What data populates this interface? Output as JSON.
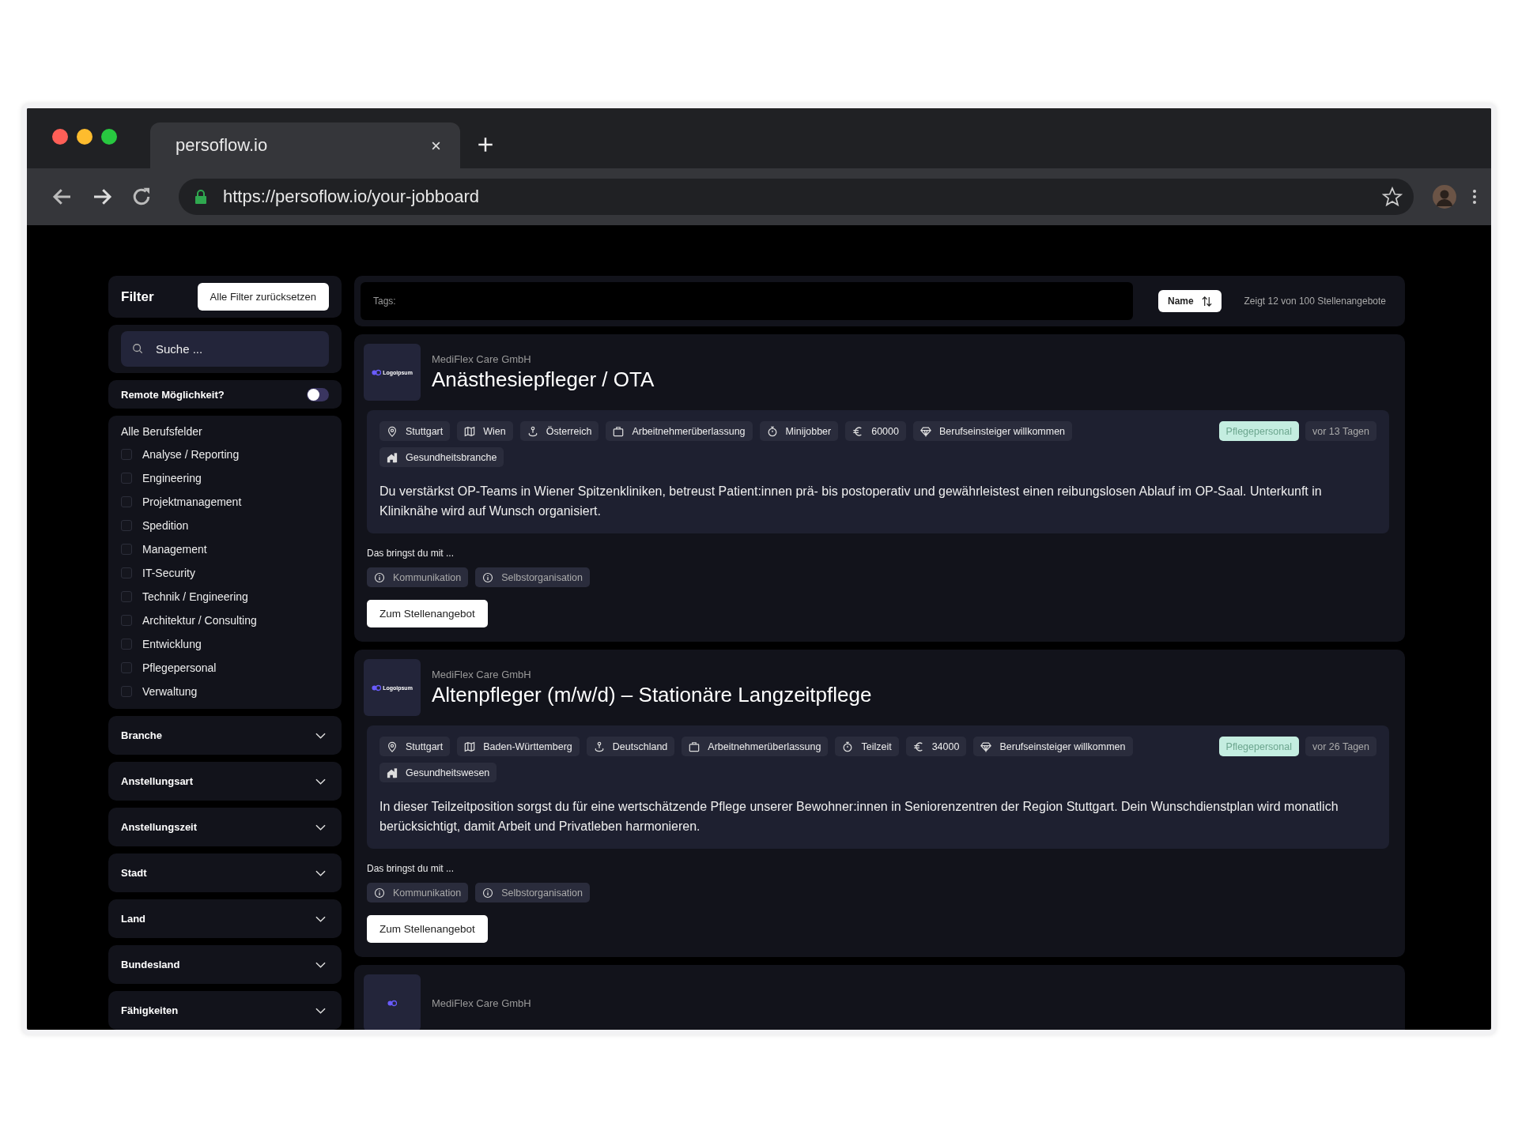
{
  "browser": {
    "tab_title": "persoflow.io",
    "url": "https://persoflow.io/your-jobboard"
  },
  "sidebar": {
    "title": "Filter",
    "reset_button": "Alle Filter zurücksetzen",
    "search_placeholder": "Suche ...",
    "remote": {
      "label": "Remote Möglichkeit?",
      "on": false
    },
    "fields": {
      "title": "Alle Berufsfelder",
      "items": [
        {
          "label": "Analyse / Reporting",
          "checked": false
        },
        {
          "label": "Engineering",
          "checked": false
        },
        {
          "label": "Projektmanagement",
          "checked": false
        },
        {
          "label": "Spedition",
          "checked": false
        },
        {
          "label": "Management",
          "checked": false
        },
        {
          "label": "IT-Security",
          "checked": false
        },
        {
          "label": "Technik / Engineering",
          "checked": false
        },
        {
          "label": "Architektur / Consulting",
          "checked": false
        },
        {
          "label": "Entwicklung",
          "checked": false
        },
        {
          "label": "Pflegepersonal",
          "checked": false
        },
        {
          "label": "Verwaltung",
          "checked": false
        }
      ]
    },
    "sections": [
      {
        "label": "Branche",
        "expanded": false
      },
      {
        "label": "Anstellungsart",
        "expanded": false
      },
      {
        "label": "Anstellungszeit",
        "expanded": false
      },
      {
        "label": "Stadt",
        "expanded": false
      },
      {
        "label": "Land",
        "expanded": false
      },
      {
        "label": "Bundesland",
        "expanded": false
      },
      {
        "label": "Fähigkeiten",
        "expanded": false
      }
    ]
  },
  "toolbar": {
    "tags_label": "Tags:",
    "sort_button": "Name",
    "count": "Zeigt 12 von 100 Stellenangebote"
  },
  "jobs": [
    {
      "logo_text": "Logoipsum",
      "company": "MediFlex Care GmbH",
      "title": "Anästhesiepfleger / OTA",
      "tags": [
        {
          "kind": "city",
          "label": "Stuttgart"
        },
        {
          "kind": "region",
          "label": "Wien"
        },
        {
          "kind": "country",
          "label": "Österreich"
        },
        {
          "kind": "type",
          "label": "Arbeitnehmerüberlassung"
        },
        {
          "kind": "time",
          "label": "Minijobber"
        },
        {
          "kind": "salary",
          "label": "60000"
        },
        {
          "kind": "level",
          "label": "Berufseinsteiger willkommen"
        },
        {
          "kind": "industry",
          "label": "Gesundheitsbranche"
        }
      ],
      "category": "Pflegepersonal",
      "age": "vor 13 Tagen",
      "description": "Du verstärkst OP-Teams in Wiener Spitzenkliniken, betreust Patient:innen prä- bis postoperativ und gewährleistest einen reibungslosen Ablauf im OP-Saal. Unterkunft in Kliniknähe wird auf Wunsch organisiert.",
      "skills_label": "Das bringst du mit ...",
      "skills": [
        "Kommunikation",
        "Selbstorganisation"
      ],
      "button": "Zum Stellenangebot"
    },
    {
      "logo_text": "Logoipsum",
      "company": "MediFlex Care GmbH",
      "title": "Altenpfleger (m/w/d) – Stationäre Langzeitpflege",
      "tags": [
        {
          "kind": "city",
          "label": "Stuttgart"
        },
        {
          "kind": "region",
          "label": "Baden-Württemberg"
        },
        {
          "kind": "country",
          "label": "Deutschland"
        },
        {
          "kind": "type",
          "label": "Arbeitnehmerüberlassung"
        },
        {
          "kind": "time",
          "label": "Teilzeit"
        },
        {
          "kind": "salary",
          "label": "34000"
        },
        {
          "kind": "level",
          "label": "Berufseinsteiger willkommen"
        },
        {
          "kind": "industry",
          "label": "Gesundheitswesen"
        }
      ],
      "category": "Pflegepersonal",
      "age": "vor 26 Tagen",
      "description": "In dieser Teilzeitposition sorgst du für eine wertschätzende Pflege unserer Bewohner:innen in Seniorenzentren der Region Stuttgart. Dein Wunschdienstplan wird monatlich berücksichtigt, damit Arbeit und Privatleben harmonieren.",
      "skills_label": "Das bringst du mit ...",
      "skills": [
        "Kommunikation",
        "Selbstorganisation"
      ],
      "button": "Zum Stellenangebot"
    },
    {
      "company": "MediFlex Care GmbH"
    }
  ]
}
